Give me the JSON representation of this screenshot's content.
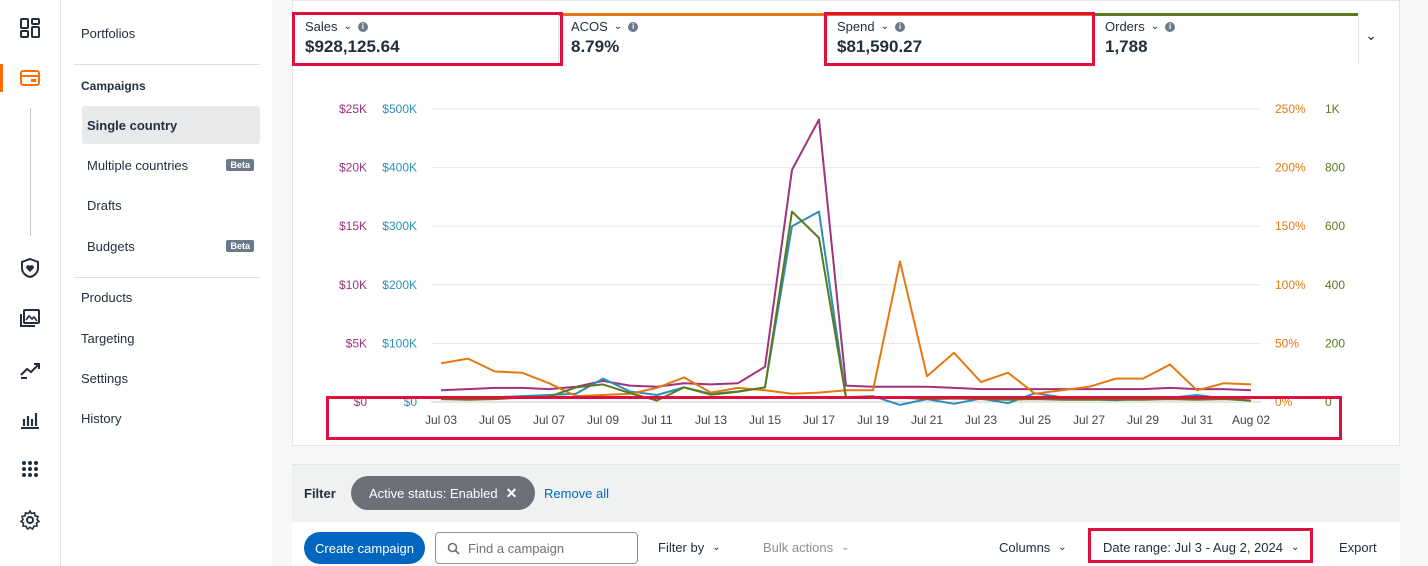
{
  "sidebar": {
    "portfolios": "Portfolios",
    "campaigns_section": "Campaigns",
    "campaign_items": [
      {
        "label": "Single country"
      },
      {
        "label": "Multiple countries",
        "badge": "Beta"
      },
      {
        "label": "Drafts"
      },
      {
        "label": "Budgets",
        "badge": "Beta"
      }
    ],
    "products": "Products",
    "targeting": "Targeting",
    "settings": "Settings",
    "history": "History"
  },
  "metrics": [
    {
      "label": "Sales",
      "value": "$928,125.64",
      "color": "#ffffff"
    },
    {
      "label": "ACOS",
      "value": "8.79%",
      "color": "#e47911"
    },
    {
      "label": "Spend",
      "value": "$81,590.27",
      "color": "#e47911"
    },
    {
      "label": "Orders",
      "value": "1,788",
      "color": "#5a7a1c"
    }
  ],
  "filter": {
    "label": "Filter",
    "chip": "Active status: Enabled",
    "remove_all": "Remove all"
  },
  "toolbar": {
    "create": "Create campaign",
    "search_placeholder": "Find a campaign",
    "filter_by": "Filter by",
    "bulk_actions": "Bulk actions",
    "columns": "Columns",
    "date_range": "Date range: Jul 3 - Aug 2, 2024",
    "export": "Export"
  },
  "colors": {
    "spend": "#a0337e",
    "sales": "#2b8fbd",
    "acos": "#e47911",
    "orders": "#5a7a1c",
    "highlight": "#e0103e"
  },
  "chart_data": {
    "type": "line",
    "x": [
      "Jul 03",
      "Jul 04",
      "Jul 05",
      "Jul 06",
      "Jul 07",
      "Jul 08",
      "Jul 09",
      "Jul 10",
      "Jul 11",
      "Jul 12",
      "Jul 13",
      "Jul 14",
      "Jul 15",
      "Jul 16",
      "Jul 17",
      "Jul 18",
      "Jul 19",
      "Jul 20",
      "Jul 21",
      "Jul 22",
      "Jul 23",
      "Jul 24",
      "Jul 25",
      "Jul 26",
      "Jul 27",
      "Jul 28",
      "Jul 29",
      "Jul 30",
      "Jul 31",
      "Aug 01",
      "Aug 02"
    ],
    "xticks": [
      "Jul 03",
      "Jul 05",
      "Jul 07",
      "Jul 09",
      "Jul 11",
      "Jul 13",
      "Jul 15",
      "Jul 17",
      "Jul 19",
      "Jul 21",
      "Jul 23",
      "Jul 25",
      "Jul 27",
      "Jul 29",
      "Jul 31",
      "Aug 02"
    ],
    "axes": {
      "spend": {
        "ticks": [
          "$0",
          "$5K",
          "$10K",
          "$15K",
          "$20K",
          "$25K"
        ],
        "max": 25000
      },
      "sales": {
        "ticks": [
          "$0",
          "$100K",
          "$200K",
          "$300K",
          "$400K",
          "$500K"
        ],
        "max": 500000
      },
      "acos": {
        "ticks": [
          "0%",
          "50%",
          "100%",
          "150%",
          "200%",
          "250%"
        ],
        "max": 250
      },
      "orders": {
        "ticks": [
          "0",
          "200",
          "400",
          "600",
          "800",
          "1K"
        ],
        "max": 1000
      }
    },
    "series": [
      {
        "name": "Spend",
        "axis": "spend",
        "values": [
          1000,
          1100,
          1200,
          1200,
          1100,
          1300,
          1800,
          1400,
          1300,
          1600,
          1500,
          1600,
          3000,
          19800,
          24100,
          1400,
          1300,
          1300,
          1300,
          1200,
          1100,
          1100,
          1100,
          1100,
          1100,
          1100,
          1100,
          1200,
          1100,
          1100,
          1000
        ]
      },
      {
        "name": "Sales",
        "axis": "sales",
        "values": [
          5000,
          6000,
          8000,
          10000,
          12000,
          14000,
          40000,
          18000,
          12000,
          25000,
          14000,
          18000,
          25000,
          300000,
          325000,
          8000,
          10000,
          -5000,
          5000,
          -3000,
          6000,
          -2000,
          15000,
          8000,
          5000,
          3000,
          6000,
          7000,
          12000,
          6000,
          2000
        ]
      },
      {
        "name": "ACOS",
        "axis": "acos",
        "values": [
          33,
          37,
          26,
          25,
          16,
          5,
          6,
          7,
          12,
          21,
          8,
          12,
          10,
          7,
          8,
          10,
          10,
          120,
          22,
          42,
          17,
          25,
          7,
          10,
          13,
          20,
          20,
          32,
          10,
          16,
          15
        ]
      },
      {
        "name": "Orders",
        "axis": "orders",
        "values": [
          10,
          8,
          10,
          15,
          18,
          50,
          60,
          30,
          5,
          50,
          25,
          35,
          50,
          650,
          560,
          15,
          15,
          15,
          10,
          12,
          10,
          8,
          10,
          8,
          8,
          8,
          8,
          10,
          8,
          10,
          5
        ]
      }
    ]
  }
}
